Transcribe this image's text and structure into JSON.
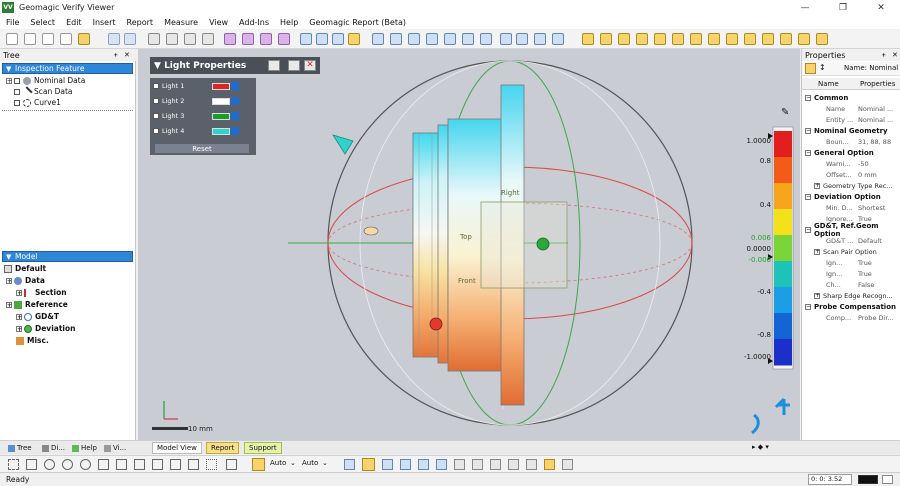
{
  "app": {
    "logo": "VV",
    "title": "Geomagic Verify Viewer"
  },
  "window_controls": {
    "minimize": "—",
    "restore": "❐",
    "close": "✕"
  },
  "menu": [
    "File",
    "Select",
    "Edit",
    "Insert",
    "Report",
    "Measure",
    "View",
    "Add-Ins",
    "Help",
    "Geomagic Report (Beta)"
  ],
  "tree_panel": {
    "title": "Tree",
    "pin": "ᚐ",
    "close": "✕",
    "header": "Inspection Feature",
    "items": [
      {
        "label": "Nominal Data"
      },
      {
        "label": "Scan Data"
      },
      {
        "label": "Curve1"
      }
    ]
  },
  "model_panel": {
    "header": "Model",
    "items": [
      {
        "label": "Default"
      },
      {
        "label": "Data"
      },
      {
        "label": "Section"
      },
      {
        "label": "Reference"
      },
      {
        "label": "GD&T"
      },
      {
        "label": "Deviation"
      },
      {
        "label": "Misc."
      }
    ]
  },
  "light_properties": {
    "title": "Light Properties",
    "lights": [
      {
        "label": "Light 1",
        "color": "#e02424"
      },
      {
        "label": "Light 2",
        "color": "#ffffff"
      },
      {
        "label": "Light 3",
        "color": "#1a9e2a"
      },
      {
        "label": "Light 4",
        "color": "#2fd3c9"
      }
    ],
    "reset_label": "Reset"
  },
  "viewport_labels": {
    "top": "Top",
    "front": "Front",
    "right": "Right",
    "scale_bar": "10 mm"
  },
  "color_scale": {
    "labels": [
      "1.0000",
      "0.8",
      "0.4",
      "0.006",
      "0.0000",
      "-0.006",
      "-0.4",
      "-0.8",
      "-1.0000"
    ],
    "colors": [
      "#e21f1f",
      "#f35b18",
      "#f7a51c",
      "#f3e21b",
      "#7bd43a",
      "#1ec2b8",
      "#1b9ee6",
      "#1464d6",
      "#1b2fc9"
    ]
  },
  "bottom_tabs": {
    "left": [
      "Tree",
      "Di...",
      "Help",
      "Vi..."
    ],
    "right": [
      "Model View",
      "Report",
      "Support"
    ]
  },
  "bottom_toolbar": {
    "auto1": "Auto",
    "auto2": "Auto"
  },
  "status": {
    "ready": "Ready",
    "timer": "0: 0: 3.52"
  },
  "properties": {
    "title": "Properties",
    "name_label": "Name: Nominal",
    "col_name": "Name",
    "col_props": "Properties",
    "rows": [
      {
        "type": "section",
        "label": "Common"
      },
      {
        "type": "row",
        "name": "Name",
        "value": "Nominal ..."
      },
      {
        "type": "row",
        "name": "Entity ...",
        "value": "Nominal ..."
      },
      {
        "type": "section",
        "label": "Nominal Geometry"
      },
      {
        "type": "row",
        "name": "Boun...",
        "value": "31, 88, 88"
      },
      {
        "type": "section",
        "label": "General Option"
      },
      {
        "type": "row",
        "name": "Warni...",
        "value": "-50"
      },
      {
        "type": "row",
        "name": "Offset...",
        "value": "0 mm"
      },
      {
        "type": "sub",
        "label": "Geometry Type Rec..."
      },
      {
        "type": "section",
        "label": "Deviation Option"
      },
      {
        "type": "row",
        "name": "Min. D...",
        "value": "Shortest"
      },
      {
        "type": "row",
        "name": "Ignore...",
        "value": "True"
      },
      {
        "type": "section",
        "label": "GD&T, Ref.Geom Option"
      },
      {
        "type": "row",
        "name": "GD&T ...",
        "value": "Default"
      },
      {
        "type": "sub",
        "label": "Scan Pair Option"
      },
      {
        "type": "row",
        "name": "Ign...",
        "value": "True"
      },
      {
        "type": "row",
        "name": "Ign...",
        "value": "True"
      },
      {
        "type": "row",
        "name": "Ch...",
        "value": "False"
      },
      {
        "type": "sub",
        "label": "Sharp Edge Recogn..."
      },
      {
        "type": "section",
        "label": "Probe Compensation"
      },
      {
        "type": "row",
        "name": "Comp...",
        "value": "Probe Dir..."
      }
    ]
  }
}
